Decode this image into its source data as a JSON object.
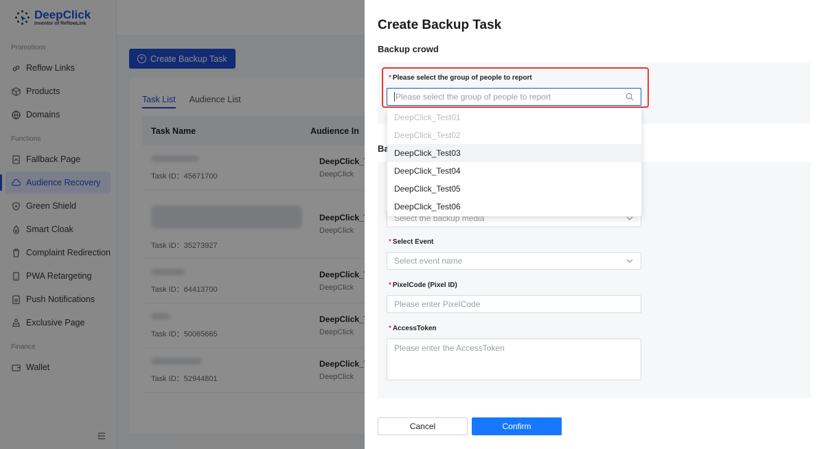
{
  "brand": {
    "name": "DeepClick",
    "tagline": "Inventor of ReflowLink",
    "color": "#1f4fd6"
  },
  "sidebar": {
    "sections": [
      {
        "label": "Promotions",
        "items": [
          {
            "label": "Reflow Links",
            "icon": "link-icon"
          },
          {
            "label": "Products",
            "icon": "box-icon"
          },
          {
            "label": "Domains",
            "icon": "globe-icon"
          }
        ]
      },
      {
        "label": "Functions",
        "items": [
          {
            "label": "Fallback Page",
            "icon": "page-icon"
          },
          {
            "label": "Audience Recovery",
            "icon": "cloud-icon",
            "active": true
          },
          {
            "label": "Green Shield",
            "icon": "shield-icon"
          },
          {
            "label": "Smart Cloak",
            "icon": "cloak-icon"
          },
          {
            "label": "Complaint Redirection",
            "icon": "trash-icon"
          },
          {
            "label": "PWA Retargeting",
            "icon": "phone-icon"
          },
          {
            "label": "Push Notifications",
            "icon": "bell-icon"
          },
          {
            "label": "Exclusive Page",
            "icon": "crown-icon"
          }
        ]
      },
      {
        "label": "Finance",
        "items": [
          {
            "label": "Wallet",
            "icon": "wallet-icon"
          }
        ]
      }
    ]
  },
  "main": {
    "create_button": "Create Backup Task",
    "tabs": [
      {
        "label": "Task List",
        "active": true
      },
      {
        "label": "Audience List"
      }
    ],
    "columns": [
      "Task Name",
      "Audience In"
    ],
    "rows": [
      {
        "task_id": "Task ID：45671700",
        "audience": "DeepClick_T",
        "sub": "DeepClick"
      },
      {
        "task_id": "Task ID：35273927",
        "audience": "DeepClick_T",
        "sub": "DeepClick"
      },
      {
        "task_id": "Task ID：64413700",
        "audience": "DeepClick_T",
        "sub": "DeepClick"
      },
      {
        "task_id": "Task ID：50065665",
        "audience": "DeepClick_T",
        "sub": "DeepClick"
      },
      {
        "task_id": "Task ID：52944801",
        "audience": "DeepClick_T",
        "sub": "DeepClick"
      }
    ]
  },
  "drawer": {
    "title": "Create Backup Task",
    "section1": "Backup crowd",
    "section2": "Ba",
    "group_label": "Please select the group of people to report",
    "group_placeholder": "Please select the group of people to report",
    "group_options": [
      {
        "label": "DeepClick_Test01",
        "disabled": true
      },
      {
        "label": "DeepClick_Test02",
        "disabled": true
      },
      {
        "label": "DeepClick_Test03",
        "hover": true
      },
      {
        "label": "DeepClick_Test04"
      },
      {
        "label": "DeepClick_Test05"
      },
      {
        "label": "DeepClick_Test06"
      }
    ],
    "media_placeholder": "Select the backup media",
    "event_label": "Select Event",
    "event_placeholder": "Select event name",
    "pixel_label": "PixelCode (Pixel ID)",
    "pixel_placeholder": "Please enter PixelCode",
    "token_label": "AccessToken",
    "token_placeholder": "Please enter the AccessToken",
    "cancel": "Cancel",
    "confirm": "Confirm"
  }
}
